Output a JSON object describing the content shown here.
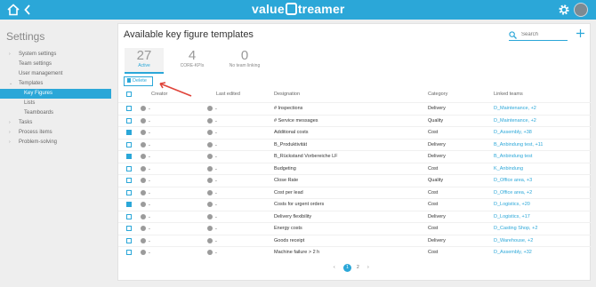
{
  "header": {
    "logo_text_a": "value",
    "logo_text_b": "treamer"
  },
  "sidebar": {
    "title": "Settings",
    "items": [
      {
        "label": "System settings",
        "arrow": "›"
      },
      {
        "label": "Team settings",
        "arrow": ""
      },
      {
        "label": "User management",
        "arrow": ""
      },
      {
        "label": "Templates",
        "arrow": "⌄"
      },
      {
        "label": "Key Figures",
        "arrow": ""
      },
      {
        "label": "Lists",
        "arrow": ""
      },
      {
        "label": "Teamboards",
        "arrow": ""
      },
      {
        "label": "Tasks",
        "arrow": "›"
      },
      {
        "label": "Process items",
        "arrow": "›"
      },
      {
        "label": "Problem-solving",
        "arrow": "›"
      }
    ]
  },
  "main": {
    "title": "Available key figure templates",
    "search": {
      "placeholder": "Search"
    },
    "tabs": [
      {
        "count": "27",
        "label": "Active"
      },
      {
        "count": "4",
        "label": "CORE-KPIs"
      },
      {
        "count": "0",
        "label": "No team linking"
      }
    ],
    "delete_label": "Delete",
    "columns": {
      "creator": "Creator",
      "last_edited": "Last edited",
      "designation": "Designation",
      "category": "Category",
      "linked_teams": "Linked teams"
    },
    "rows": [
      {
        "checked": false,
        "creator": "-",
        "last_edited": "-",
        "designation": "# Inspections",
        "category": "Delivery",
        "teams": "D_Maintenance, +2"
      },
      {
        "checked": false,
        "creator": "-",
        "last_edited": "-",
        "designation": "# Service messages",
        "category": "Quality",
        "teams": "D_Maintenance, +2"
      },
      {
        "checked": true,
        "creator": "-",
        "last_edited": "-",
        "designation": "Additional costs",
        "category": "Cost",
        "teams": "D_Assembly, +38"
      },
      {
        "checked": false,
        "creator": "-",
        "last_edited": "-",
        "designation": "B_Produktivität",
        "category": "Delivery",
        "teams": "B_Anbindung test, +11"
      },
      {
        "checked": true,
        "creator": "-",
        "last_edited": "-",
        "designation": "B_Rückstand Vorbereiche LF",
        "category": "Delivery",
        "teams": "B_Anbindung test"
      },
      {
        "checked": false,
        "creator": "-",
        "last_edited": "-",
        "designation": "Budgeting",
        "category": "Cost",
        "teams": "K_Anbindung"
      },
      {
        "checked": false,
        "creator": "-",
        "last_edited": "-",
        "designation": "Close Rate",
        "category": "Quality",
        "teams": "D_Office area, +3"
      },
      {
        "checked": false,
        "creator": "-",
        "last_edited": "-",
        "designation": "Cost per lead",
        "category": "Cost",
        "teams": "D_Office area, +2"
      },
      {
        "checked": true,
        "creator": "-",
        "last_edited": "-",
        "designation": "Costs for urgent orders",
        "category": "Cost",
        "teams": "D_Logistics, +20"
      },
      {
        "checked": false,
        "creator": "-",
        "last_edited": "-",
        "designation": "Delivery flexibility",
        "category": "Delivery",
        "teams": "D_Logistics, +17"
      },
      {
        "checked": false,
        "creator": "-",
        "last_edited": "-",
        "designation": "Energy costs",
        "category": "Cost",
        "teams": "D_Casting Shop, +2"
      },
      {
        "checked": false,
        "creator": "-",
        "last_edited": "-",
        "designation": "Goods receipt",
        "category": "Delivery",
        "teams": "D_Warehouse, +2"
      },
      {
        "checked": false,
        "creator": "-",
        "last_edited": "-",
        "designation": "Machine failure > 2 h",
        "category": "Cost",
        "teams": "D_Assembly, +32"
      }
    ],
    "pager": {
      "prev": "‹",
      "current": "1",
      "next_page": "2",
      "next": "›"
    }
  },
  "colors": {
    "accent": "#2ba7d8",
    "annotation": "#e0443a"
  }
}
